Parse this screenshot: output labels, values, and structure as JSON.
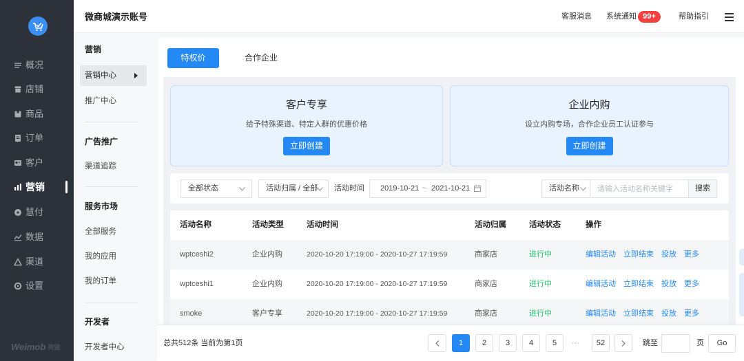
{
  "app": {
    "account_name": "微商城演示账号",
    "logo_icon": "cart-logo-icon",
    "brand_wordmark": "Weimob",
    "brand_cn": "微盟"
  },
  "header": {
    "service_msg": "客服消息",
    "notify_label": "系统通知",
    "notify_badge": "99+",
    "help_label": "帮助指引",
    "menu_icon": "hamburger-icon"
  },
  "primary_nav": {
    "items": [
      {
        "label": "概况",
        "icon": "list-icon"
      },
      {
        "label": "店铺",
        "icon": "store-icon"
      },
      {
        "label": "商品",
        "icon": "goods-icon"
      },
      {
        "label": "订单",
        "icon": "order-icon"
      },
      {
        "label": "客户",
        "icon": "customer-icon"
      },
      {
        "label": "营销",
        "icon": "marketing-icon",
        "active": true
      },
      {
        "label": "慧付",
        "icon": "pay-icon"
      },
      {
        "label": "数据",
        "icon": "data-icon"
      },
      {
        "label": "渠道",
        "icon": "channel-icon"
      },
      {
        "label": "设置",
        "icon": "settings-icon"
      }
    ]
  },
  "secondary_nav": {
    "groups": [
      {
        "title": "营销",
        "items": [
          {
            "label": "营销中心",
            "active": true
          },
          {
            "label": "推广中心"
          }
        ]
      },
      {
        "title": "广告推广",
        "items": [
          {
            "label": "渠道追踪"
          }
        ]
      },
      {
        "title": "服务市场",
        "items": [
          {
            "label": "全部服务"
          },
          {
            "label": "我的应用"
          },
          {
            "label": "我的订单"
          }
        ]
      },
      {
        "title": "开发者",
        "items": [
          {
            "label": "开发者中心"
          }
        ]
      }
    ],
    "active_indicator_icon": "caret-right-icon"
  },
  "tabs": [
    {
      "label": "特权价",
      "active": true
    },
    {
      "label": "合作企业",
      "active": false
    }
  ],
  "cards": [
    {
      "title": "客户专享",
      "desc": "给予特殊渠道、特定人群的优惠价格",
      "button": "立即创建"
    },
    {
      "title": "企业内购",
      "desc": "设立内购专场，合作企业员工认证参与",
      "button": "立即创建"
    }
  ],
  "filters": {
    "status_select": "全部状态",
    "owner_select": "活动归属 / 全部",
    "time_label": "活动时间",
    "date_start": "2019-10-21",
    "date_sep": "~",
    "date_end": "2021-10-21",
    "date_icon": "calendar-icon",
    "name_select": "活动名称",
    "search_placeholder": "请输入活动名称关键字",
    "search_button": "搜索"
  },
  "table": {
    "columns": [
      "活动名称",
      "活动类型",
      "活动时间",
      "活动归属",
      "活动状态",
      "操作"
    ],
    "rows": [
      {
        "name": "wptceshi2",
        "type": "企业内购",
        "time": "2020-10-20 17:19:00 - 2020-10-27 17:19:59",
        "owner": "商家店",
        "status": "进行中",
        "actions": [
          "编辑活动",
          "立即结束",
          "投放",
          "更多"
        ]
      },
      {
        "name": "wptceshi1",
        "type": "企业内购",
        "time": "2020-10-20 17:19:00 - 2020-10-27 17:19:59",
        "owner": "商家店",
        "status": "进行中",
        "actions": [
          "编辑活动",
          "立即结束",
          "投放",
          "更多"
        ]
      },
      {
        "name": "smoke",
        "type": "客户专享",
        "time": "2020-10-20 17:19:00 - 2020-10-27 17:19:59",
        "owner": "商家店",
        "status": "进行中",
        "actions": [
          "编辑活动",
          "立即结束",
          "投放",
          "更多"
        ]
      }
    ]
  },
  "pagination": {
    "summary": "总共512条 当前为第1页",
    "prev_icon": "chevron-left-icon",
    "next_icon": "chevron-right-icon",
    "pages": [
      {
        "label": "1",
        "current": true
      },
      {
        "label": "2"
      },
      {
        "label": "3"
      },
      {
        "label": "4"
      },
      {
        "label": "5"
      }
    ],
    "ellipsis": "···",
    "last_page": "52",
    "jump_label": "跳至",
    "page_unit": "页",
    "go_button": "Go"
  },
  "colors": {
    "primary": "#2589f5",
    "sidebar_bg": "#2d3139",
    "badge_red": "#f5403d",
    "status_green": "#1fbf6b",
    "card_bg": "#e9f3fe"
  }
}
